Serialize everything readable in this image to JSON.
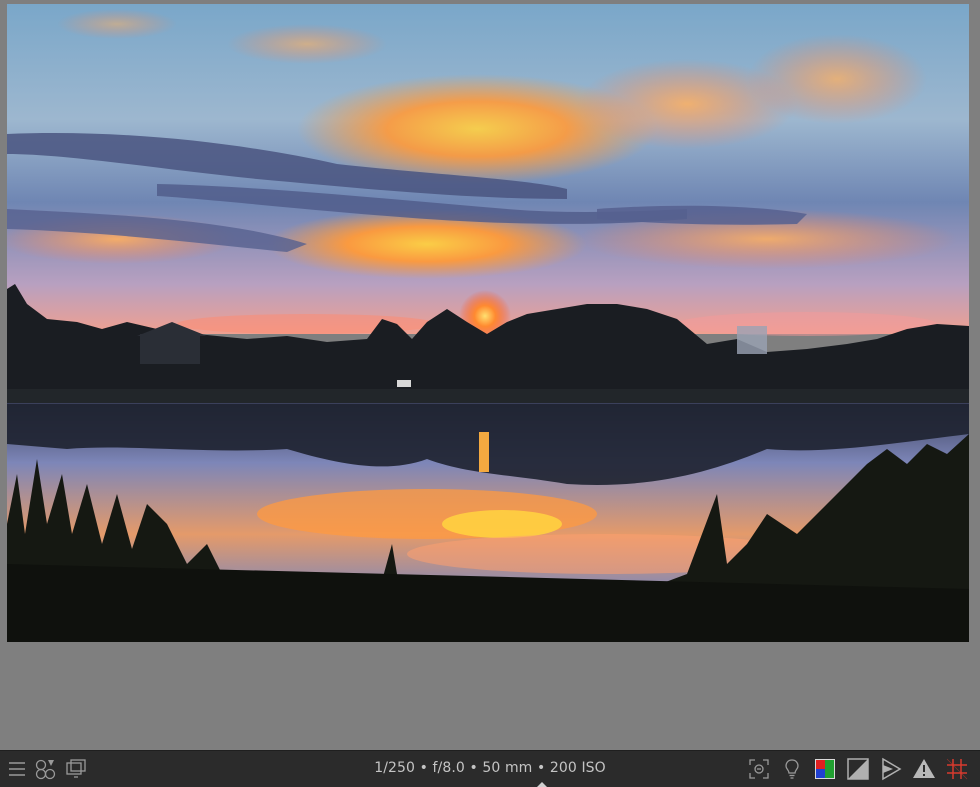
{
  "viewer": {
    "image": "sunset over lake with tree silhouettes reflected in water"
  },
  "bottombar": {
    "exif_text": "1/250 • f/8.0 • 50 mm • 200 ISO",
    "left_icons": [
      "menu-icon",
      "styles-icon",
      "display-icon"
    ],
    "right_icons": [
      "focus-peaking-icon",
      "bulb-icon",
      "color-assessment-icon",
      "softproof-icon",
      "gamut-check-icon",
      "overexposure-warning-icon",
      "guides-icon"
    ]
  },
  "colors": {
    "bar_bg": "#2b2b2b",
    "viewer_bg": "#7f7f7f",
    "icon": "#9a9a9a",
    "guides_accent": "#d83a2e"
  }
}
